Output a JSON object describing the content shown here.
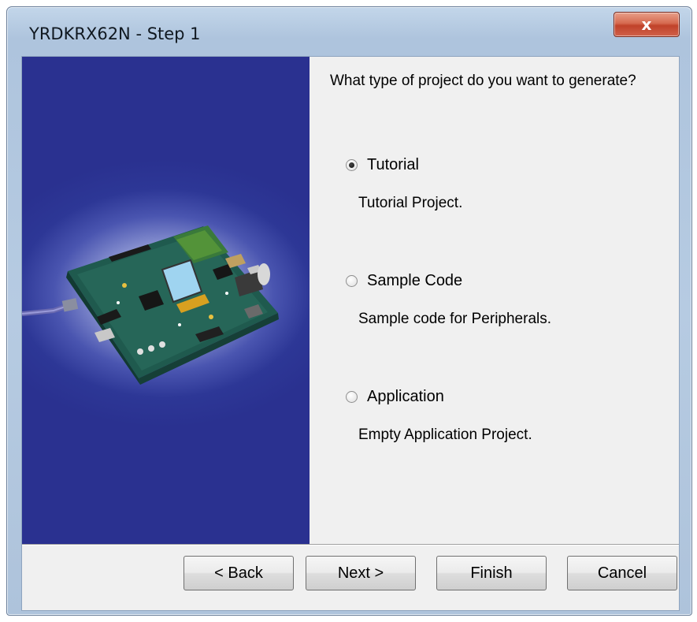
{
  "window": {
    "title": "YRDKRX62N - Step 1",
    "close_label": "x"
  },
  "content": {
    "question": "What type of project do you want to generate?",
    "options": [
      {
        "label": "Tutorial",
        "description": "Tutorial Project.",
        "selected": true
      },
      {
        "label": "Sample Code",
        "description": "Sample code for Peripherals.",
        "selected": false
      },
      {
        "label": "Application",
        "description": "Empty Application Project.",
        "selected": false
      }
    ]
  },
  "buttons": {
    "back": "< Back",
    "next": "Next >",
    "finish": "Finish",
    "cancel": "Cancel"
  },
  "colors": {
    "panel_blue": "#2d3796",
    "close_red": "#c0422a",
    "dialog_bg": "#f0f0f0"
  }
}
